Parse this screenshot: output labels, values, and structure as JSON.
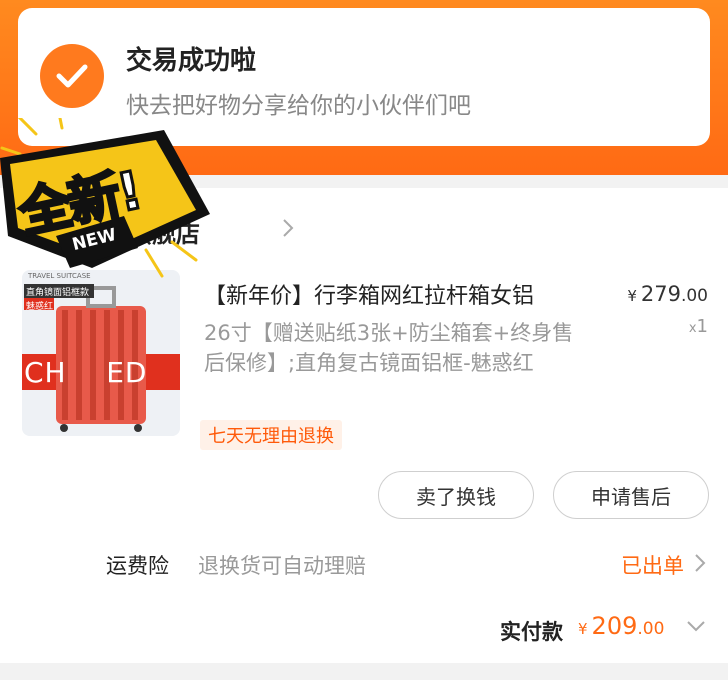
{
  "status": {
    "title": "交易成功啦",
    "subtitle": "快去把好物分享给你的小伙伴们吧"
  },
  "sticker": {
    "main": "全新!",
    "tag": "NEW"
  },
  "shop": {
    "name": "旗舰店"
  },
  "product": {
    "title": "【新年价】行李箱网红拉杆箱女铝",
    "desc": "26寸【赠送贴纸3张+防尘箱套+终身售后保修】;直角复古镜面铝框-魅惑红",
    "price_currency": "¥",
    "price_int": "279",
    "price_dec": ".00",
    "qty_prefix": "x",
    "qty": "1",
    "tag": "七天无理由退换",
    "thumb_banner": "直角镜面铝框款",
    "thumb_color": "魅惑红",
    "thumb_top": "TRAVEL SUITCASE",
    "thumb_stripe": "CH    ED"
  },
  "actions": {
    "sell_label": "卖了换钱",
    "after_sale_label": "申请售后"
  },
  "insurance": {
    "label": "运费险",
    "desc": "退换货可自动理赔",
    "status": "已出单"
  },
  "payment": {
    "label": "实付款",
    "currency": "¥",
    "int": "209",
    "dec": ".00"
  },
  "colors": {
    "accent": "#ff6a14",
    "header": "#ff8a1f"
  }
}
